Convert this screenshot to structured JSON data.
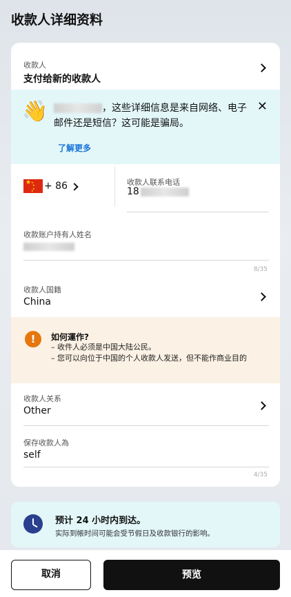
{
  "header": {
    "title": "收款人详细资料"
  },
  "payee": {
    "label": "收款人",
    "value": "支付给新的收款人"
  },
  "alert": {
    "text": "，这些详细信息是来自网络、电子邮件还是短信？这可能是骗局。",
    "link": "了解更多",
    "close": "✕",
    "wave": "👋"
  },
  "phone": {
    "country_code": "+ 86",
    "label": "收款人联系电话",
    "value_prefix": "18"
  },
  "account_name": {
    "label": "收款账户持有人姓名",
    "counter": "8/35"
  },
  "nationality": {
    "label": "收款人国籍",
    "value": "China"
  },
  "info": {
    "title": "如何運作?",
    "line1": "– 收件人必须是中国大陆公民。",
    "line2": "– 您可以向位于中国的个人收款人发送，但不能作商业目的"
  },
  "relationship": {
    "label": "收款人关系",
    "value": "Other"
  },
  "save_as": {
    "label": "保存收款人為",
    "value": "self",
    "counter": "4/35"
  },
  "eta": {
    "title": "预计 24 小时内到达。",
    "subtitle": "实际到帳时间可能会受节假日及收款银行的影响。"
  },
  "footer": {
    "cancel": "取消",
    "preview": "预览"
  },
  "colors": {
    "accent": "#1b74d9",
    "alert_bg": "#e3f7f9",
    "info_bg": "#fbf1e4",
    "warning": "#e6760f"
  }
}
